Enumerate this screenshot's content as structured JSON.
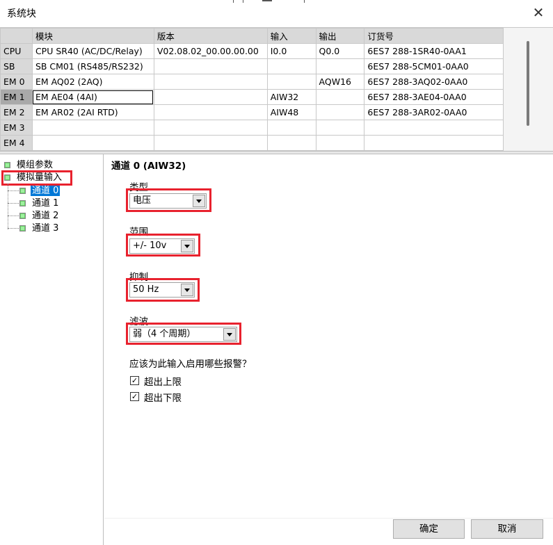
{
  "window": {
    "title": "系统块"
  },
  "grid": {
    "headers": [
      "",
      "模块",
      "版本",
      "输入",
      "输出",
      "订货号"
    ],
    "rows": [
      [
        "CPU",
        "CPU SR40 (AC/DC/Relay)",
        "V02.08.02_00.00.00.00",
        "I0.0",
        "Q0.0",
        "6ES7 288-1SR40-0AA1"
      ],
      [
        "SB",
        "SB CM01 (RS485/RS232)",
        "",
        "",
        "",
        "6ES7 288-5CM01-0AA0"
      ],
      [
        "EM 0",
        "EM AQ02 (2AQ)",
        "",
        "",
        "AQW16",
        "6ES7 288-3AQ02-0AA0"
      ],
      [
        "EM 1",
        "EM AE04 (4AI)",
        "",
        "AIW32",
        "",
        "6ES7 288-3AE04-0AA0"
      ],
      [
        "EM 2",
        "EM AR02 (2AI RTD)",
        "",
        "AIW48",
        "",
        "6ES7 288-3AR02-0AA0"
      ],
      [
        "EM 3",
        "",
        "",
        "",
        "",
        ""
      ],
      [
        "EM 4",
        "",
        "",
        "",
        "",
        ""
      ]
    ]
  },
  "tree": {
    "module_params": "模组参数",
    "analog_input": "模拟量输入",
    "channels": [
      "通道 0",
      "通道 1",
      "通道 2",
      "通道 3"
    ]
  },
  "panel": {
    "channel_title": "通道 0 (AIW32)",
    "type_label": "类型",
    "type_value": "电压",
    "range_label": "范围",
    "range_value": "+/- 10v",
    "rejection_label": "抑制",
    "rejection_value": "50 Hz",
    "filter_label": "滤波",
    "filter_value": "弱（4 个周期）",
    "alarm_question": "应该为此输入启用哪些报警？",
    "alarm_upper": "超出上限",
    "alarm_lower": "超出下限",
    "alarm_upper_checked": true,
    "alarm_lower_checked": true
  },
  "buttons": {
    "ok": "确定",
    "cancel": "取消"
  },
  "colors": {
    "highlight": "#e8222e",
    "selection": "#0078d7"
  }
}
